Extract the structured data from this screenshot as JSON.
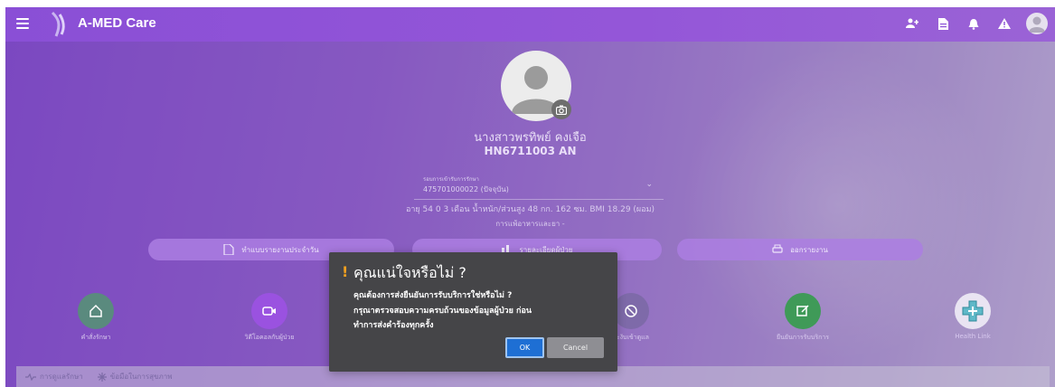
{
  "header": {
    "title": "A-MED Care",
    "icons": [
      "menu-icon",
      "add-user-icon",
      "document-icon",
      "bell-icon",
      "warning-icon",
      "profile-avatar"
    ]
  },
  "patient": {
    "name": "นางสาวพรทิพย์ คงเจือ",
    "hn": "HN6711003 AN",
    "visit_label": "รอบการเข้ารับการรักษา",
    "visit_value": "475701000022 (ปัจจุบัน)",
    "age_line": "อายุ 54 0 3 เดือน น้ำหนัก/ส่วนสูง 48 กก. 162 ซม. BMI 18.29 (ผอม)",
    "allergy_line": "การแพ้อาหารและยา -"
  },
  "actions": {
    "daily_report": "ทำแบบรายงานประจำวัน",
    "patient_list": "รายละเอียดผู้ป่วย",
    "print_report": "ออกรายงาน"
  },
  "menu_circles": [
    {
      "label": "คำสั่งรักษา"
    },
    {
      "label": "วิดีโอคอลกับผู้ป่วย"
    },
    {
      "label": "ระงับเข้าดูแล"
    },
    {
      "label": "ยืนยันการรับบริการ"
    },
    {
      "label": "Health Link"
    }
  ],
  "bottom_tabs": {
    "tab1": "การดูแลรักษา",
    "tab2": "ข้อมือในการสุขภาพ"
  },
  "dialog": {
    "title": "คุณแน่ใจหรือไม่ ?",
    "line1": "คุณต้องการส่งยืนยันการรับบริการใช่หรือไม่ ?",
    "line2": "กรุณาตรวจสอบความครบถ้วนของข้อมูลผู้ป่วย ก่อน",
    "line3": "ทำการส่งคำร้องทุกครั้ง",
    "ok": "OK",
    "cancel": "Cancel"
  },
  "colors": {
    "topbar": "#8a4fd6",
    "ok_button": "#1e6fd4",
    "cancel_button": "#8e8e93",
    "dialog_bg": "#454548",
    "warn": "#f0a020"
  }
}
